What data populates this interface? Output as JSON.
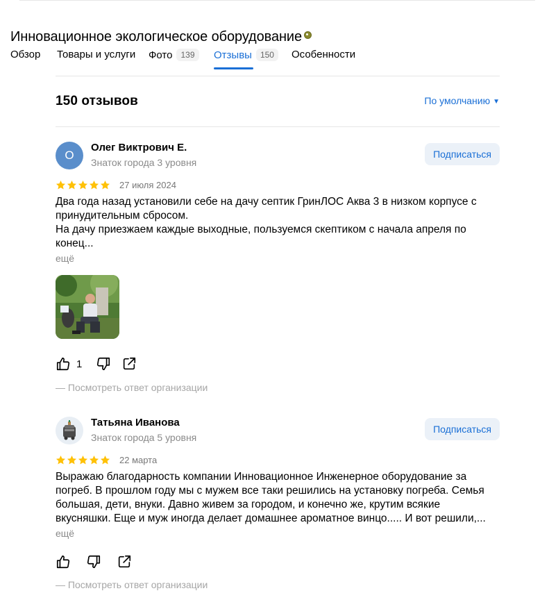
{
  "org": {
    "title": "Инновационное экологическое оборудование"
  },
  "tabs": [
    {
      "label": "Обзор",
      "count": ""
    },
    {
      "label": "Товары и услуги",
      "count": ""
    },
    {
      "label": "Фото",
      "count": "139"
    },
    {
      "label": "Отзывы",
      "count": "150",
      "active": true
    },
    {
      "label": "Особенности",
      "count": ""
    }
  ],
  "reviews_header": {
    "count_label": "150 отзывов",
    "sort_label": "По умолчанию"
  },
  "reviews": [
    {
      "avatar_letter": "О",
      "author": "Олег Виктрович Е.",
      "level": "Знаток города 3 уровня",
      "subscribe_label": "Подписаться",
      "rating": 5,
      "date": "27 июля 2024",
      "text": "Два года назад установили себе на дачу септик ГринЛОС Аква 3 в низком корпусе с\nпринудительным сбросом.\nНа дачу приезжаем каждые выходные, пользуемся скептиком с начала апреля по\nконец...",
      "more_label": "ещё",
      "likes": "1",
      "response_label": "— Посмотреть ответ организации"
    },
    {
      "avatar_letter": "",
      "author": "Татьяна Иванова",
      "level": "Знаток города 5 уровня",
      "subscribe_label": "Подписаться",
      "rating": 5,
      "date": "22 марта",
      "text": "Выражаю благодарность компании Инновационное Инженерное оборудование за\nпогреб. В прошлом году мы с мужем все таки решились на установку погреба. Семья\nбольшая, дети, внуки. Давно живем за городом, и конечно же, крутим всякие\nвкусняшки. Еще и муж иногда делает домашнее ароматное винцо..... И вот решили,...",
      "more_label": "ещё",
      "likes": "",
      "response_label": "— Посмотреть ответ организации"
    }
  ],
  "colors": {
    "accent": "#1a6fd6",
    "star": "#ffc107",
    "muted": "#8a8a8a"
  }
}
